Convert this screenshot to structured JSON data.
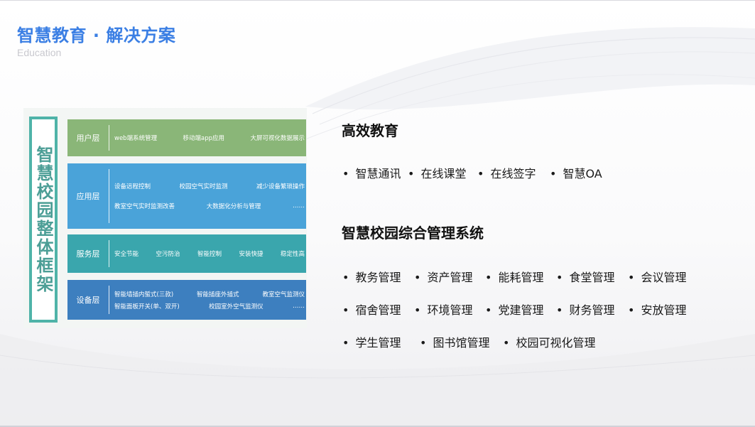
{
  "header": {
    "title": "智慧教育 · 解决方案",
    "subtitle": "Education"
  },
  "diagram": {
    "side_title": "智慧校园整体框架",
    "layers": [
      {
        "name": "用户层",
        "rows": [
          [
            "web端系统管理",
            "移动端app应用",
            "大屏可视化数据展示"
          ]
        ]
      },
      {
        "name": "应用层",
        "rows": [
          [
            "设备远程控制",
            "校园空气实时监测",
            "减少设备繁琐操作"
          ],
          [
            "教室空气实时监测改善",
            "大数据化分析与管理",
            "……"
          ]
        ]
      },
      {
        "name": "服务层",
        "rows": [
          [
            "安全节能",
            "空污防治",
            "智能控制",
            "安装快捷",
            "稳定性高"
          ]
        ]
      },
      {
        "name": "设备层",
        "rows": [
          [
            "智能墙插内蜇式(三款)",
            "智能插座外插式",
            "教室空气监测仪"
          ],
          [
            "智能面板开关(单、双开)",
            "校园室外空气监测仪",
            "……"
          ]
        ]
      }
    ]
  },
  "sections": [
    {
      "heading": "高效教育",
      "rows": [
        [
          "智慧通讯",
          "在线课堂",
          "在线签字",
          "智慧OA"
        ]
      ]
    },
    {
      "heading": "智慧校园综合管理系统",
      "rows": [
        [
          "教务管理",
          "资产管理",
          "能耗管理",
          "食堂管理",
          "会议管理"
        ],
        [
          "宿舍管理",
          "环境管理",
          "党建管理",
          "财务管理",
          "安放管理"
        ],
        [
          "学生管理",
          "图书馆管理",
          "校园可视化管理"
        ]
      ]
    }
  ],
  "colors": {
    "title_blue": "#3b7fe4",
    "user_layer": "#8ab678",
    "app_layer": "#4aa3d9",
    "service_layer": "#3aa6ad",
    "device_layer": "#3d7fbf",
    "frame_teal": "#4fb3a8"
  }
}
